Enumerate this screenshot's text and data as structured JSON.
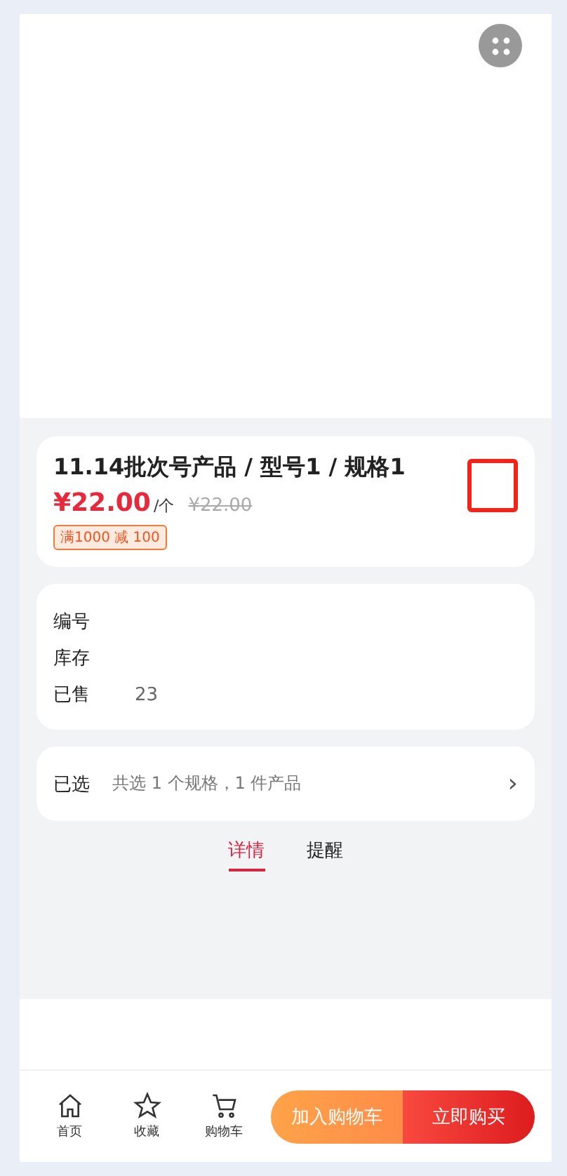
{
  "product": {
    "title": "11.14批次号产品 / 型号1 / 规格1",
    "price": "¥22.00",
    "unit": "/个",
    "original_price": "¥22.00",
    "promo_tag": "满1000 减 100"
  },
  "info": [
    {
      "label": "编号"
    },
    {
      "label": "库存"
    },
    {
      "label": "已售",
      "value": "23"
    }
  ],
  "selection": {
    "label": "已选",
    "summary": "共选 1 个规格，1 件产品",
    "chevron": "›"
  },
  "tabs": [
    {
      "label": "详情",
      "selected": true
    },
    {
      "label": "提醒",
      "selected": false
    }
  ],
  "bottom_nav": [
    {
      "label": "首页",
      "kind": "home"
    },
    {
      "label": "收藏",
      "kind": "star"
    },
    {
      "label": "购物车",
      "kind": "cart"
    }
  ],
  "actions": [
    {
      "label": "加入购物车",
      "kind": "cart"
    },
    {
      "label": "立即购买",
      "kind": "buy"
    }
  ]
}
